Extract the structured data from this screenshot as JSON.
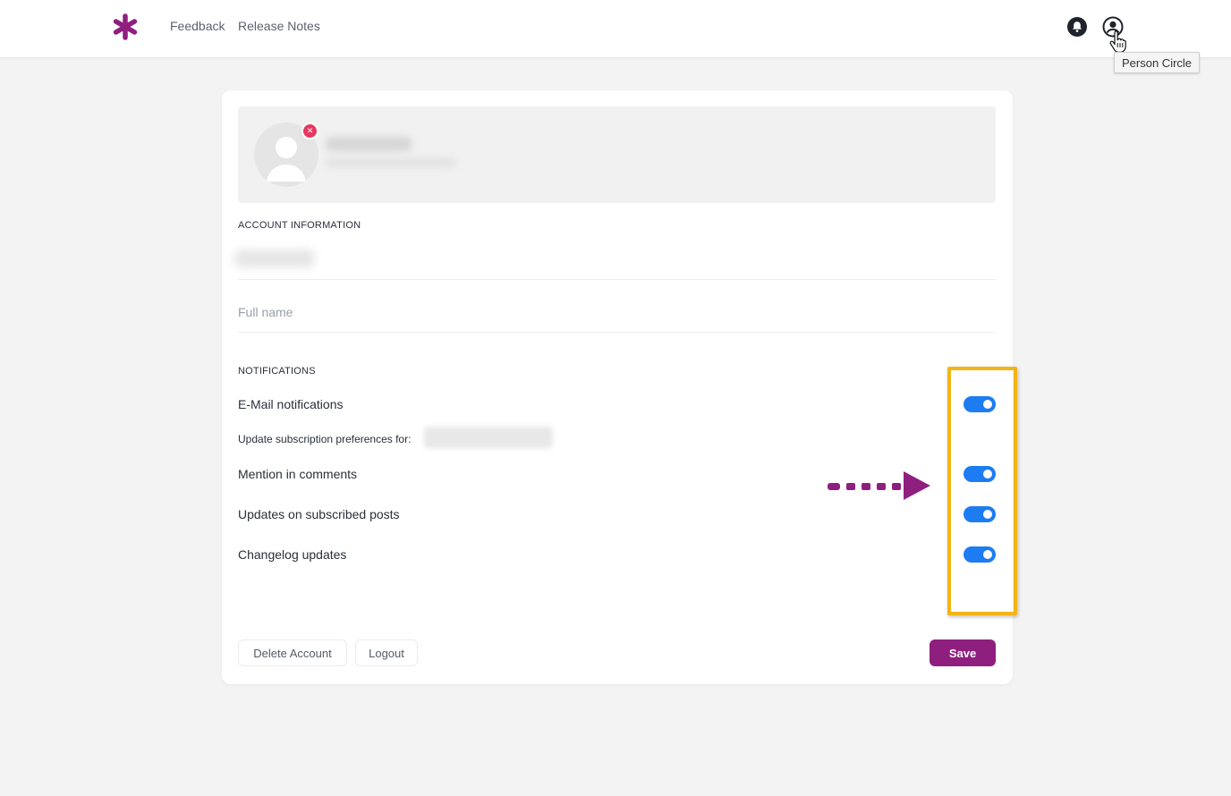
{
  "nav": {
    "links": [
      "Feedback",
      "Release Notes"
    ],
    "icons": [
      "bell-icon",
      "person-circle-icon"
    ],
    "tooltip": "Person Circle"
  },
  "account": {
    "section_label": "ACCOUNT INFORMATION",
    "full_name_placeholder": "Full name",
    "full_name_value": ""
  },
  "notifications": {
    "section_label": "NOTIFICATIONS",
    "email": {
      "label": "E-Mail notifications",
      "enabled": true
    },
    "subscription_prefs_label": "Update subscription preferences for:",
    "items": [
      {
        "label": "Mention in comments",
        "enabled": true
      },
      {
        "label": "Updates on subscribed posts",
        "enabled": true
      },
      {
        "label": "Changelog updates",
        "enabled": true
      }
    ]
  },
  "actions": {
    "delete_label": "Delete Account",
    "logout_label": "Logout",
    "save_label": "Save"
  },
  "colors": {
    "brand": "#8f1f7f",
    "toggle_on": "#1d7cf2",
    "highlight": "#f3b415",
    "remove_badge": "#e8385f"
  }
}
